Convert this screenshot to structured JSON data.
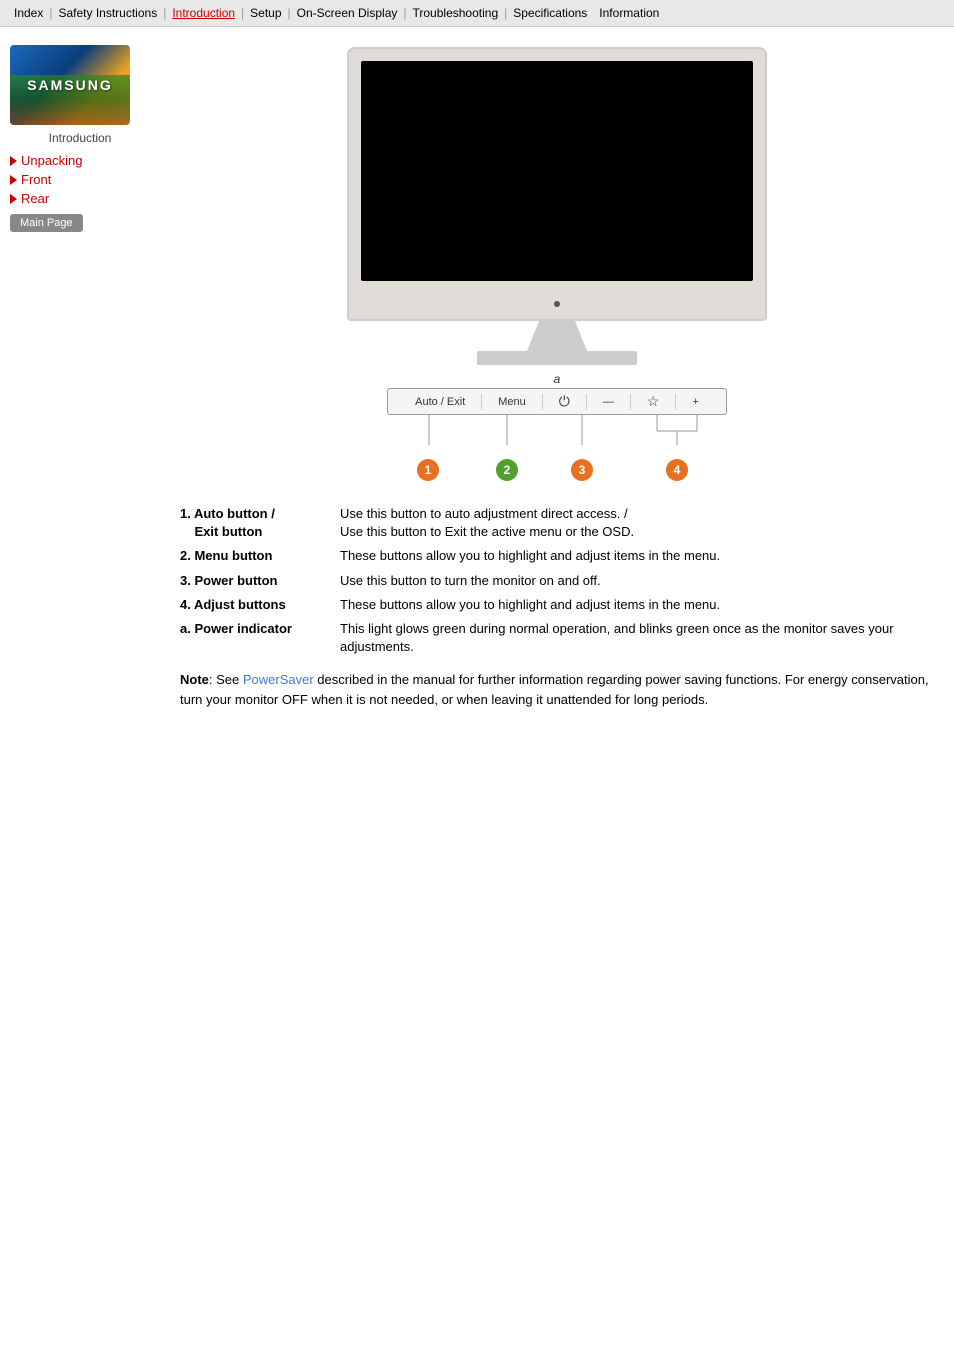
{
  "navbar": {
    "items": [
      {
        "label": "Index",
        "active": false
      },
      {
        "label": "Safety Instructions",
        "active": false
      },
      {
        "label": "Introduction",
        "active": true
      },
      {
        "label": "Setup",
        "active": false
      },
      {
        "label": "On-Screen Display",
        "active": false
      },
      {
        "label": "Troubleshooting",
        "active": false
      },
      {
        "label": "Specifications",
        "active": false
      },
      {
        "label": "Information",
        "active": false
      }
    ]
  },
  "sidebar": {
    "brand": "SAMSUNG",
    "intro_label": "Introduction",
    "items": [
      {
        "label": "Unpacking"
      },
      {
        "label": "Front"
      },
      {
        "label": "Rear"
      }
    ],
    "main_page_btn": "Main Page"
  },
  "monitor": {
    "button_labels": [
      "Auto / Exit",
      "Menu",
      "",
      "—",
      "☆",
      "+"
    ]
  },
  "descriptions": [
    {
      "key": "1.  Auto button /\n    Exit button",
      "key_label": "1.",
      "key_name": "Auto button /",
      "key_name2": "Exit button",
      "value": "Use this button to auto adjustment direct access. /\nUse this button to Exit the active menu or the OSD."
    },
    {
      "key": "2.  Menu button",
      "key_label": "2.",
      "key_name": "Menu button",
      "value": "These buttons allow you to highlight and adjust items in the menu."
    },
    {
      "key": "3.  Power button",
      "key_label": "3.",
      "key_name": "Power button",
      "value": "Use this button to turn the monitor on and off."
    },
    {
      "key": "4.  Adjust buttons",
      "key_label": "4.",
      "key_name": "Adjust buttons",
      "value": "These buttons allow you to highlight and adjust items in the menu."
    },
    {
      "key": "a.  Power indicator",
      "key_label": "a.",
      "key_name": "Power indicator",
      "value": "This light glows green during normal operation, and blinks green once as the monitor saves your adjustments."
    }
  ],
  "note": {
    "label": "Note",
    "link_text": "PowerSaver",
    "text_before": ": See ",
    "text_after": " described in the manual for further information regarding power saving functions. For energy conservation, turn your monitor OFF when it is not needed, or when leaving it unattended for long periods."
  }
}
